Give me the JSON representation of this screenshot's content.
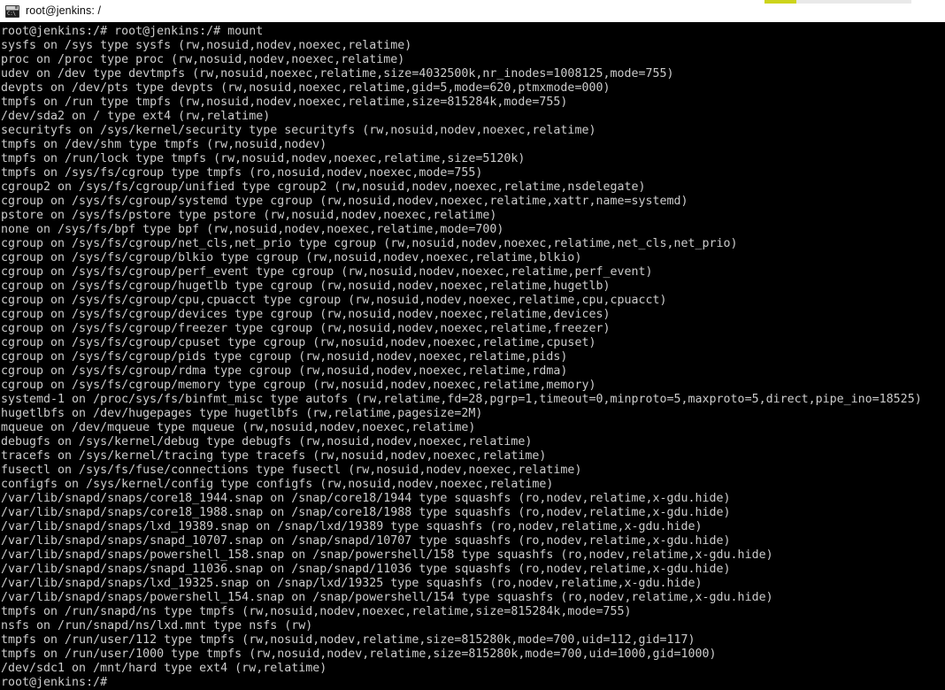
{
  "window": {
    "title": "root@jenkins: /",
    "icon": "console-icon",
    "icon_text": "C:\\",
    "accent_color": "#cdd41b",
    "titlebar_bg": "#ffffff",
    "terminal_bg": "#000000",
    "terminal_fg": "#cccccc"
  },
  "terminal": {
    "prompt": "root@jenkins:/#",
    "command": "mount",
    "lines": [
      "root@jenkins:/# root@jenkins:/# mount",
      "sysfs on /sys type sysfs (rw,nosuid,nodev,noexec,relatime)",
      "proc on /proc type proc (rw,nosuid,nodev,noexec,relatime)",
      "udev on /dev type devtmpfs (rw,nosuid,noexec,relatime,size=4032500k,nr_inodes=1008125,mode=755)",
      "devpts on /dev/pts type devpts (rw,nosuid,noexec,relatime,gid=5,mode=620,ptmxmode=000)",
      "tmpfs on /run type tmpfs (rw,nosuid,nodev,noexec,relatime,size=815284k,mode=755)",
      "/dev/sda2 on / type ext4 (rw,relatime)",
      "securityfs on /sys/kernel/security type securityfs (rw,nosuid,nodev,noexec,relatime)",
      "tmpfs on /dev/shm type tmpfs (rw,nosuid,nodev)",
      "tmpfs on /run/lock type tmpfs (rw,nosuid,nodev,noexec,relatime,size=5120k)",
      "tmpfs on /sys/fs/cgroup type tmpfs (ro,nosuid,nodev,noexec,mode=755)",
      "cgroup2 on /sys/fs/cgroup/unified type cgroup2 (rw,nosuid,nodev,noexec,relatime,nsdelegate)",
      "cgroup on /sys/fs/cgroup/systemd type cgroup (rw,nosuid,nodev,noexec,relatime,xattr,name=systemd)",
      "pstore on /sys/fs/pstore type pstore (rw,nosuid,nodev,noexec,relatime)",
      "none on /sys/fs/bpf type bpf (rw,nosuid,nodev,noexec,relatime,mode=700)",
      "cgroup on /sys/fs/cgroup/net_cls,net_prio type cgroup (rw,nosuid,nodev,noexec,relatime,net_cls,net_prio)",
      "cgroup on /sys/fs/cgroup/blkio type cgroup (rw,nosuid,nodev,noexec,relatime,blkio)",
      "cgroup on /sys/fs/cgroup/perf_event type cgroup (rw,nosuid,nodev,noexec,relatime,perf_event)",
      "cgroup on /sys/fs/cgroup/hugetlb type cgroup (rw,nosuid,nodev,noexec,relatime,hugetlb)",
      "cgroup on /sys/fs/cgroup/cpu,cpuacct type cgroup (rw,nosuid,nodev,noexec,relatime,cpu,cpuacct)",
      "cgroup on /sys/fs/cgroup/devices type cgroup (rw,nosuid,nodev,noexec,relatime,devices)",
      "cgroup on /sys/fs/cgroup/freezer type cgroup (rw,nosuid,nodev,noexec,relatime,freezer)",
      "cgroup on /sys/fs/cgroup/cpuset type cgroup (rw,nosuid,nodev,noexec,relatime,cpuset)",
      "cgroup on /sys/fs/cgroup/pids type cgroup (rw,nosuid,nodev,noexec,relatime,pids)",
      "cgroup on /sys/fs/cgroup/rdma type cgroup (rw,nosuid,nodev,noexec,relatime,rdma)",
      "cgroup on /sys/fs/cgroup/memory type cgroup (rw,nosuid,nodev,noexec,relatime,memory)",
      "systemd-1 on /proc/sys/fs/binfmt_misc type autofs (rw,relatime,fd=28,pgrp=1,timeout=0,minproto=5,maxproto=5,direct,pipe_ino=18525)",
      "hugetlbfs on /dev/hugepages type hugetlbfs (rw,relatime,pagesize=2M)",
      "mqueue on /dev/mqueue type mqueue (rw,nosuid,nodev,noexec,relatime)",
      "debugfs on /sys/kernel/debug type debugfs (rw,nosuid,nodev,noexec,relatime)",
      "tracefs on /sys/kernel/tracing type tracefs (rw,nosuid,nodev,noexec,relatime)",
      "fusectl on /sys/fs/fuse/connections type fusectl (rw,nosuid,nodev,noexec,relatime)",
      "configfs on /sys/kernel/config type configfs (rw,nosuid,nodev,noexec,relatime)",
      "/var/lib/snapd/snaps/core18_1944.snap on /snap/core18/1944 type squashfs (ro,nodev,relatime,x-gdu.hide)",
      "/var/lib/snapd/snaps/core18_1988.snap on /snap/core18/1988 type squashfs (ro,nodev,relatime,x-gdu.hide)",
      "/var/lib/snapd/snaps/lxd_19389.snap on /snap/lxd/19389 type squashfs (ro,nodev,relatime,x-gdu.hide)",
      "/var/lib/snapd/snaps/snapd_10707.snap on /snap/snapd/10707 type squashfs (ro,nodev,relatime,x-gdu.hide)",
      "/var/lib/snapd/snaps/powershell_158.snap on /snap/powershell/158 type squashfs (ro,nodev,relatime,x-gdu.hide)",
      "/var/lib/snapd/snaps/snapd_11036.snap on /snap/snapd/11036 type squashfs (ro,nodev,relatime,x-gdu.hide)",
      "/var/lib/snapd/snaps/lxd_19325.snap on /snap/lxd/19325 type squashfs (ro,nodev,relatime,x-gdu.hide)",
      "/var/lib/snapd/snaps/powershell_154.snap on /snap/powershell/154 type squashfs (ro,nodev,relatime,x-gdu.hide)",
      "tmpfs on /run/snapd/ns type tmpfs (rw,nosuid,nodev,noexec,relatime,size=815284k,mode=755)",
      "nsfs on /run/snapd/ns/lxd.mnt type nsfs (rw)",
      "tmpfs on /run/user/112 type tmpfs (rw,nosuid,nodev,relatime,size=815280k,mode=700,uid=112,gid=117)",
      "tmpfs on /run/user/1000 type tmpfs (rw,nosuid,nodev,relatime,size=815280k,mode=700,uid=1000,gid=1000)",
      "/dev/sdc1 on /mnt/hard type ext4 (rw,relatime)",
      "root@jenkins:/#"
    ]
  }
}
